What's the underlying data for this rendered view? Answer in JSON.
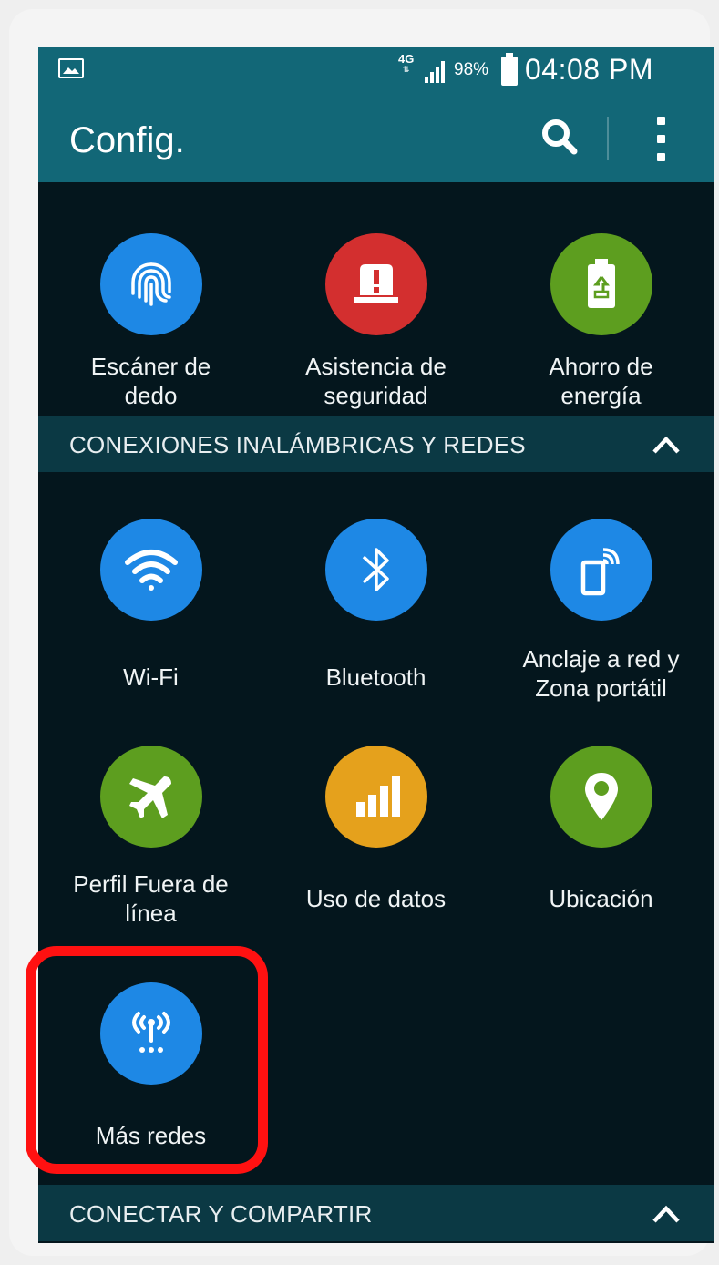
{
  "status_bar": {
    "network": "4G",
    "battery_percent": "98%",
    "time": "04:08 PM"
  },
  "action_bar": {
    "title": "Config.",
    "search_icon": "search-icon",
    "menu_icon": "overflow-menu-icon"
  },
  "top_items": [
    {
      "label": "Escáner de\ndedo",
      "icon": "fingerprint-icon",
      "color": "#1e88e5"
    },
    {
      "label": "Asistencia de\nseguridad",
      "icon": "alert-siren-icon",
      "color": "#d32f2f"
    },
    {
      "label": "Ahorro de\nenergía",
      "icon": "battery-saver-icon",
      "color": "#5d9e1f"
    }
  ],
  "sections": {
    "wireless": {
      "title": "CONEXIONES INALÁMBRICAS Y REDES"
    },
    "connect_share": {
      "title": "CONECTAR Y COMPARTIR"
    }
  },
  "wireless_items": [
    {
      "label": "Wi-Fi",
      "icon": "wifi-icon",
      "color": "#1e88e5"
    },
    {
      "label": "Bluetooth",
      "icon": "bluetooth-icon",
      "color": "#1e88e5"
    },
    {
      "label": "Anclaje a red y\nZona portátil",
      "icon": "tethering-icon",
      "color": "#1e88e5"
    },
    {
      "label": "Perfil Fuera de\nlínea",
      "icon": "airplane-icon",
      "color": "#5d9e1f"
    },
    {
      "label": "Uso de datos",
      "icon": "data-usage-icon",
      "color": "#e5a11c"
    },
    {
      "label": "Ubicación",
      "icon": "location-pin-icon",
      "color": "#5d9e1f"
    },
    {
      "label": "Más redes",
      "icon": "more-networks-icon",
      "color": "#1e88e5"
    }
  ],
  "colors": {
    "header": "#126777",
    "background": "#04161d",
    "section": "#0b3944",
    "highlight": "#ff1111"
  }
}
